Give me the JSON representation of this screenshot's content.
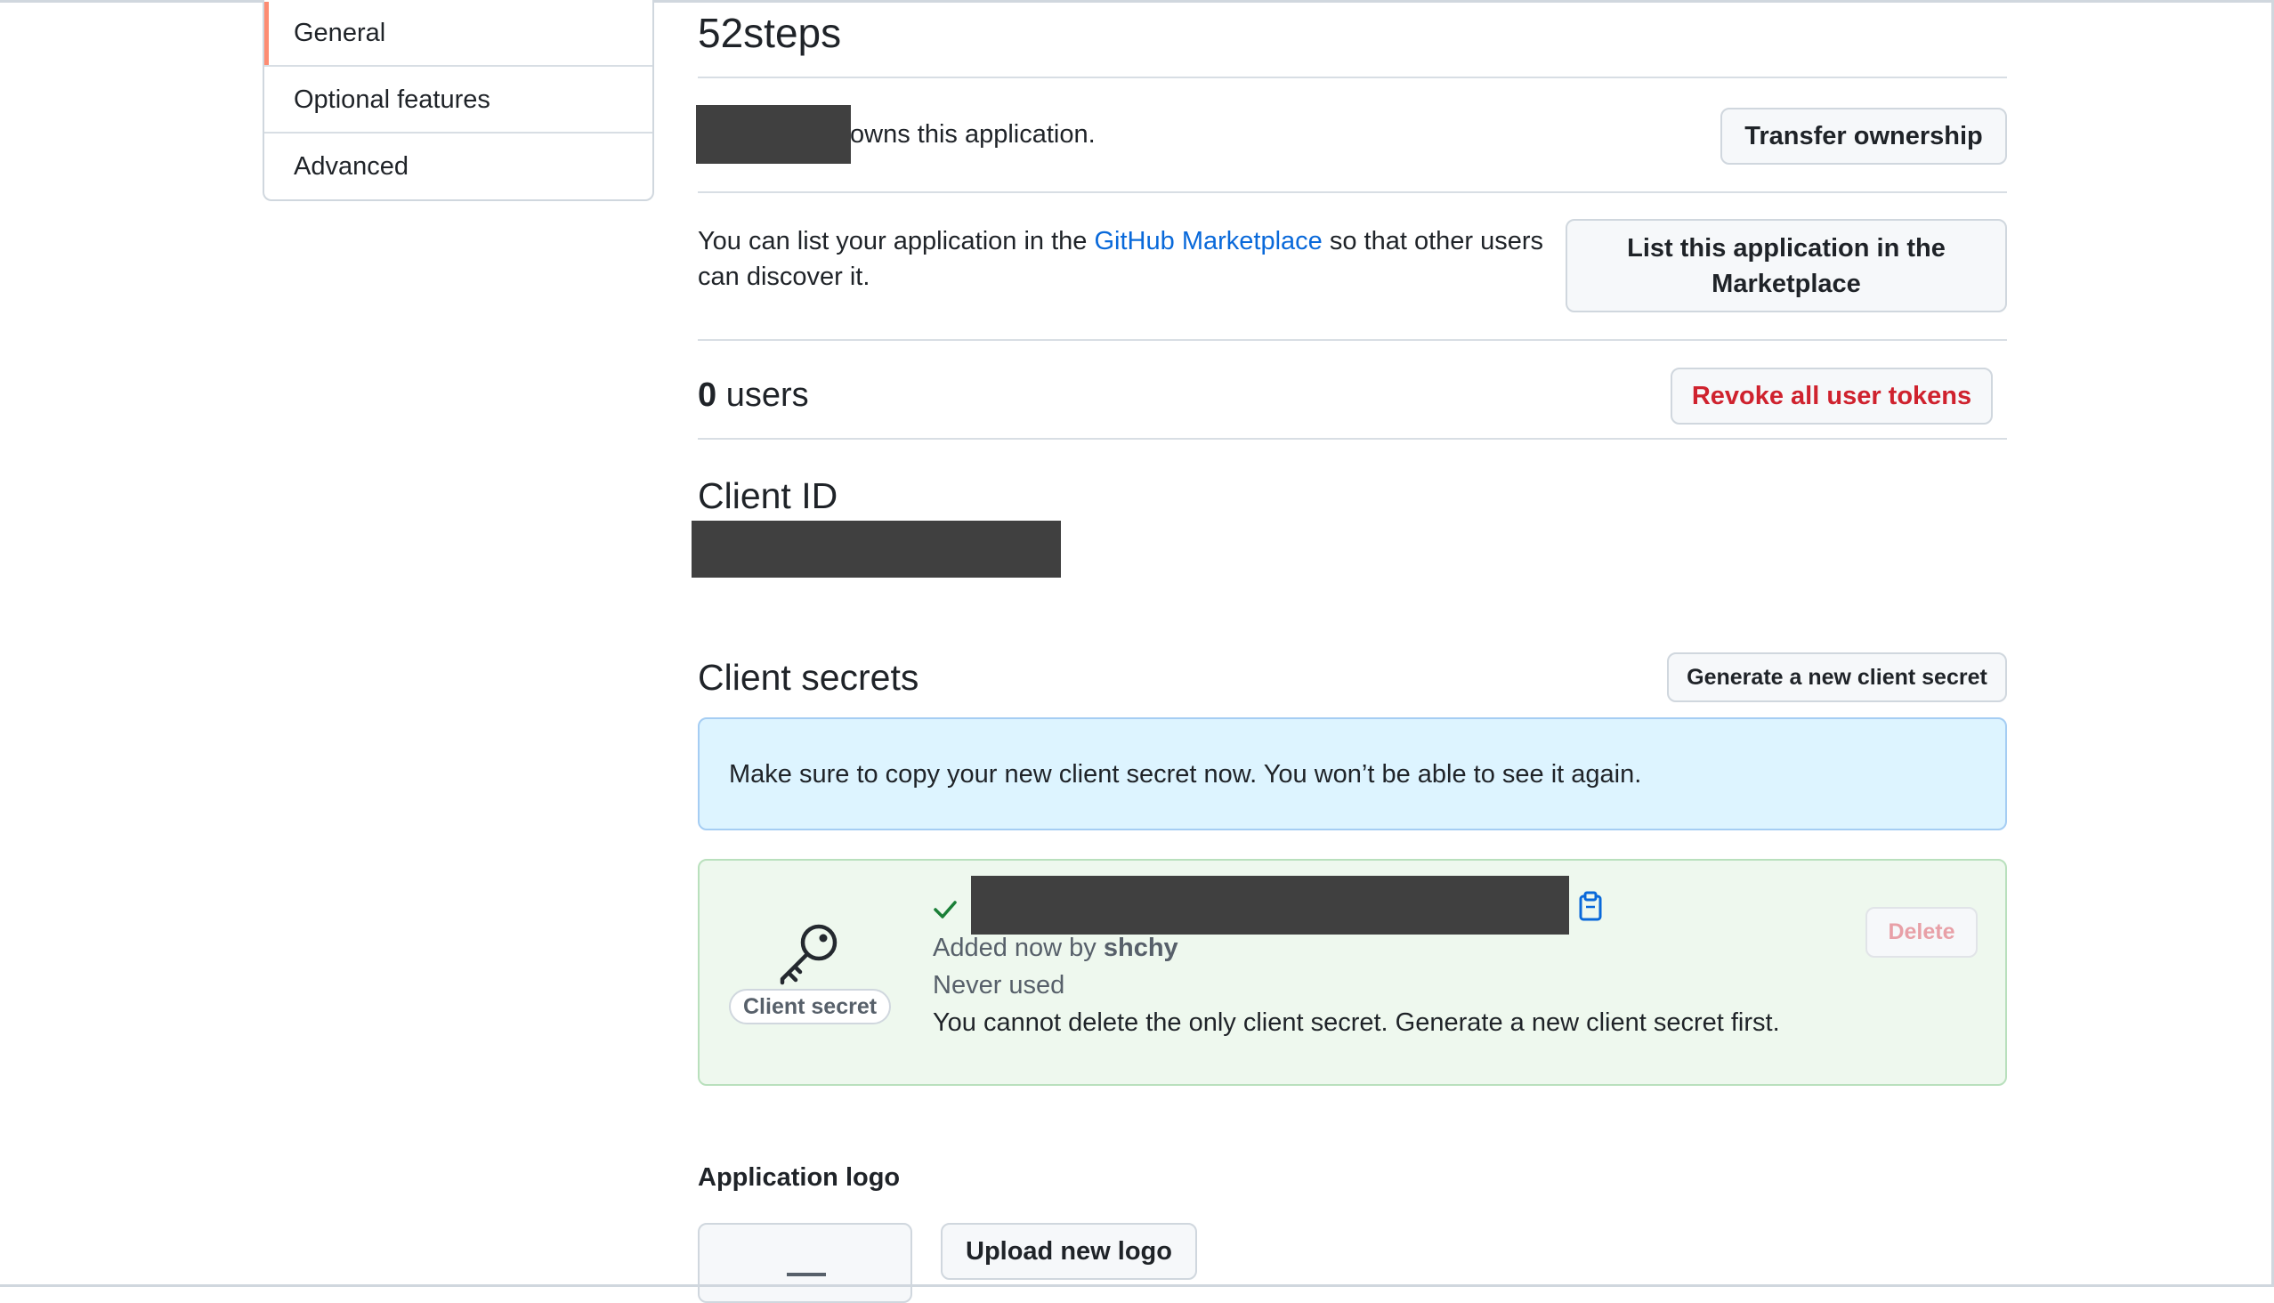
{
  "sidebar": {
    "items": [
      {
        "label": "General",
        "active": true
      },
      {
        "label": "Optional features",
        "active": false
      },
      {
        "label": "Advanced",
        "active": false
      }
    ]
  },
  "app": {
    "title": "52steps",
    "owner_suffix": "owns this application.",
    "transfer_label": "Transfer ownership"
  },
  "marketplace": {
    "text_before": "You can list your application in the ",
    "link": "GitHub Marketplace",
    "text_after": " so that other users",
    "text_line2": "can discover it.",
    "button_line1": "List this application in the",
    "button_line2": "Marketplace"
  },
  "users": {
    "count": "0",
    "label": " users",
    "revoke_label": "Revoke all user tokens"
  },
  "client_id": {
    "heading": "Client ID"
  },
  "client_secrets": {
    "heading": "Client secrets",
    "generate_label": "Generate a new client secret",
    "notice": "Make sure to copy your new client secret now. You won’t be able to see it again.",
    "secret": {
      "badge": "Client secret",
      "added_prefix": "Added now by ",
      "added_by": "shchy",
      "usage": "Never used",
      "warning": "You cannot delete the only client secret. Generate a new client secret first.",
      "delete_label": "Delete"
    }
  },
  "logo": {
    "heading": "Application logo",
    "upload_label": "Upload new logo"
  },
  "colors": {
    "accent_orange": "#fd8c73",
    "link_blue": "#0969da",
    "danger_red": "#cf222e",
    "success_green": "#1a7f37"
  }
}
